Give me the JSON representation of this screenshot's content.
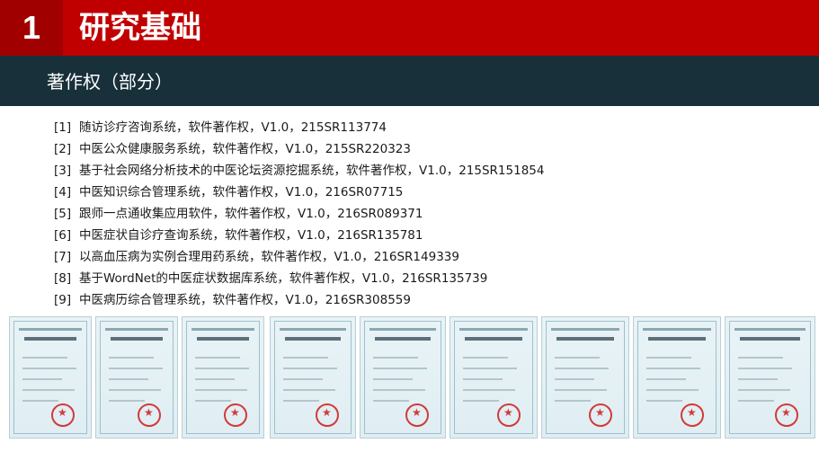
{
  "header": {
    "number": "1",
    "title": "研究基础"
  },
  "subheader": {
    "title": "著作权（部分）"
  },
  "items": [
    {
      "idx": "[1]",
      "text": "随访诊疗咨询系统，软件著作权，V1.0，215SR113774"
    },
    {
      "idx": "[2]",
      "text": "中医公众健康服务系统，软件著作权，V1.0，215SR220323"
    },
    {
      "idx": "[3]",
      "text": "基于社会网络分析技术的中医论坛资源挖掘系统，软件著作权，V1.0，215SR151854"
    },
    {
      "idx": "[4]",
      "text": "中医知识综合管理系统，软件著作权，V1.0，216SR07715"
    },
    {
      "idx": "[5]",
      "text": "跟师一点通收集应用软件，软件著作权，V1.0，216SR089371"
    },
    {
      "idx": "[6]",
      "text": "中医症状自诊疗查询系统，软件著作权，V1.0，216SR135781"
    },
    {
      "idx": "[7]",
      "text": "以高血压病为实例合理用药系统，软件著作权，V1.0，216SR149339"
    },
    {
      "idx": "[8]",
      "text": "基于WordNet的中医症状数据库系统，软件著作权，V1.0，216SR135739"
    },
    {
      "idx": "[9]",
      "text": "中医病历综合管理系统，软件著作权，V1.0，216SR308559"
    }
  ],
  "colors": {
    "title_bar": "#c00000",
    "number_box": "#a00000",
    "subheader_bar": "#17303a"
  }
}
